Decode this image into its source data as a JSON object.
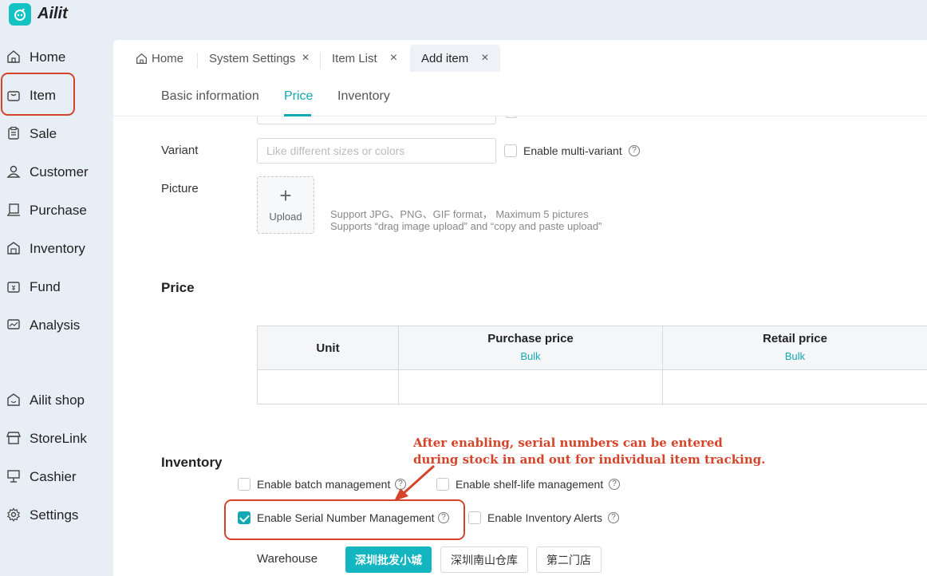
{
  "app": {
    "brand": "Ailit",
    "logo_icon": "robot-logo-icon",
    "accent": "#13a8b4",
    "annotation_color": "#d4442a"
  },
  "sidebar": {
    "items": [
      {
        "label": "Home",
        "icon": "home-icon"
      },
      {
        "label": "Item",
        "icon": "bag-icon",
        "highlighted": true
      },
      {
        "label": "Sale",
        "icon": "clipboard-icon"
      },
      {
        "label": "Customer",
        "icon": "user-icon"
      },
      {
        "label": "Purchase",
        "icon": "cart-icon"
      },
      {
        "label": "Inventory",
        "icon": "warehouse-icon"
      },
      {
        "label": "Fund",
        "icon": "wallet-icon"
      },
      {
        "label": "Analysis",
        "icon": "chart-icon"
      },
      {
        "label": "Ailit shop",
        "icon": "shop-icon"
      },
      {
        "label": "StoreLink",
        "icon": "store-icon"
      },
      {
        "label": "Cashier",
        "icon": "cashier-icon"
      },
      {
        "label": "Settings",
        "icon": "gear-icon"
      }
    ]
  },
  "tabs": [
    {
      "label": "Home",
      "closable": false
    },
    {
      "label": "System Settings",
      "closable": true
    },
    {
      "label": "Item List",
      "closable": true
    },
    {
      "label": "Add item",
      "closable": true,
      "active": true
    }
  ],
  "close_glyph": "×",
  "subtabs": [
    {
      "label": "Basic information"
    },
    {
      "label": "Price",
      "active": true
    },
    {
      "label": "Inventory"
    }
  ],
  "form": {
    "variant_label": "Variant",
    "variant_placeholder": "Like different sizes or colors",
    "multi_variant_label": "Enable multi-variant",
    "picture_label": "Picture",
    "upload_label": "Upload",
    "upload_plus": "+",
    "hint_line1": "Support JPG、PNG、GIF format， Maximum 5 pictures",
    "hint_line2": "Supports “drag image upload” and “copy and paste upload”",
    "help_glyph": "?"
  },
  "price": {
    "title": "Price",
    "columns": [
      {
        "header": "Unit",
        "sub": ""
      },
      {
        "header": "Purchase price",
        "sub": "Bulk"
      },
      {
        "header": "Retail price",
        "sub": "Bulk"
      }
    ]
  },
  "inventory": {
    "title": "Inventory",
    "annotation_line1": "After enabling, serial numbers can be entered",
    "annotation_line2": "during stock in and out for individual item tracking.",
    "options": [
      {
        "label": "Enable batch management",
        "checked": false
      },
      {
        "label": "Enable shelf-life management",
        "checked": false
      },
      {
        "label": "Enable Serial Number Management",
        "checked": true
      },
      {
        "label": "Enable Inventory Alerts",
        "checked": false
      }
    ],
    "warehouse_label": "Warehouse",
    "warehouses": [
      {
        "label": "深圳批发小城",
        "selected": true
      },
      {
        "label": "深圳南山仓库",
        "selected": false
      },
      {
        "label": "第二门店",
        "selected": false
      }
    ]
  }
}
